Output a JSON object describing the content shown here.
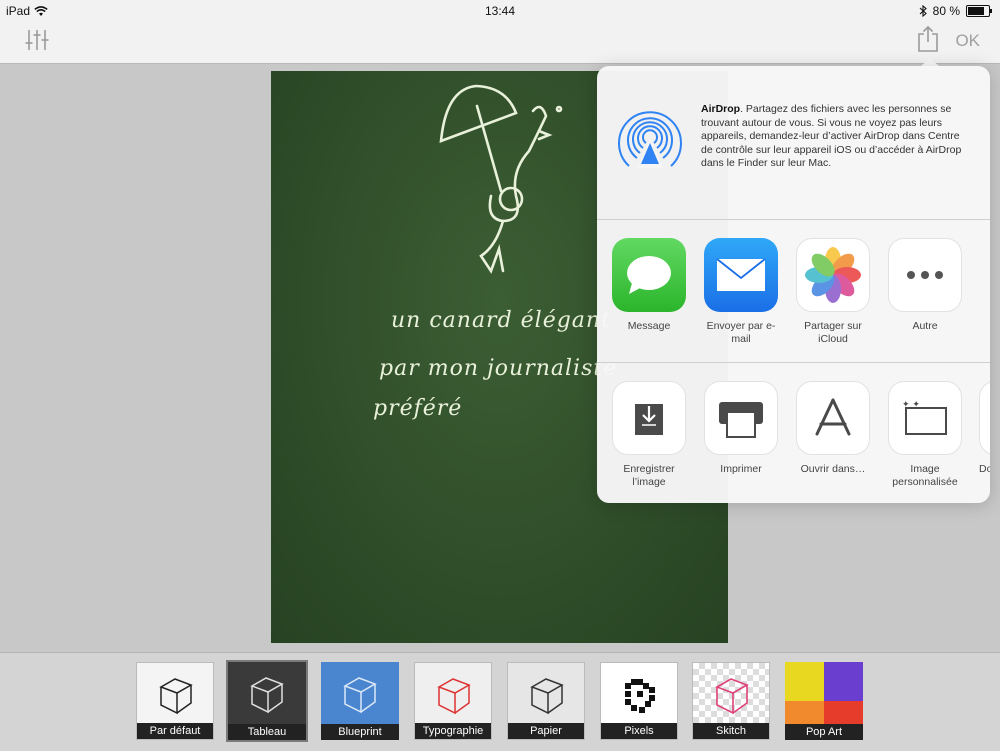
{
  "status_bar": {
    "device": "iPad",
    "time": "13:44",
    "battery": "80 %",
    "battery_level": 0.8
  },
  "toolbar": {
    "adjust_icon": "sliders-icon",
    "share_icon": "share-icon",
    "ok_label": "OK"
  },
  "board": {
    "line1": "un canard élégant",
    "line2": "par mon journaliste",
    "line3": "préféré"
  },
  "share_sheet": {
    "airdrop_title": "AirDrop",
    "airdrop_text": ". Partagez des fichiers avec les personnes se trouvant autour de vous. Si vous ne voyez pas leurs appareils, demandez-leur d’activer AirDrop dans Centre de contrôle sur leur appareil iOS ou d’accéder à AirDrop dans le Finder sur leur Mac.",
    "apps": [
      {
        "label": "Message",
        "icon": "message-icon"
      },
      {
        "label": "Envoyer par e-mail",
        "icon": "mail-icon"
      },
      {
        "label": "Partager sur iCloud",
        "icon": "photos-icon"
      },
      {
        "label": "Autre",
        "icon": "more-icon"
      }
    ],
    "actions": [
      {
        "label": "Enregistrer l’image",
        "icon": "save-image-icon"
      },
      {
        "label": "Imprimer",
        "icon": "printer-icon"
      },
      {
        "label": "Ouvrir dans…",
        "icon": "app-store-icon"
      },
      {
        "label": "Image personnalisée",
        "icon": "custom-image-icon"
      },
      {
        "label": "Do",
        "icon": "partial-action-icon"
      }
    ]
  },
  "filters": [
    {
      "label": "Par défaut",
      "selected": false
    },
    {
      "label": "Tableau",
      "selected": true
    },
    {
      "label": "Blueprint",
      "selected": false
    },
    {
      "label": "Typographie",
      "selected": false
    },
    {
      "label": "Papier",
      "selected": false
    },
    {
      "label": "Pixels",
      "selected": false
    },
    {
      "label": "Skitch",
      "selected": false
    },
    {
      "label": "Pop Art",
      "selected": false
    }
  ],
  "colors": {
    "board": "#2f4d29",
    "chalk": "#e9f1da",
    "blueprint": "#4a86cf",
    "ok_disabled": "#a0a0a0"
  }
}
